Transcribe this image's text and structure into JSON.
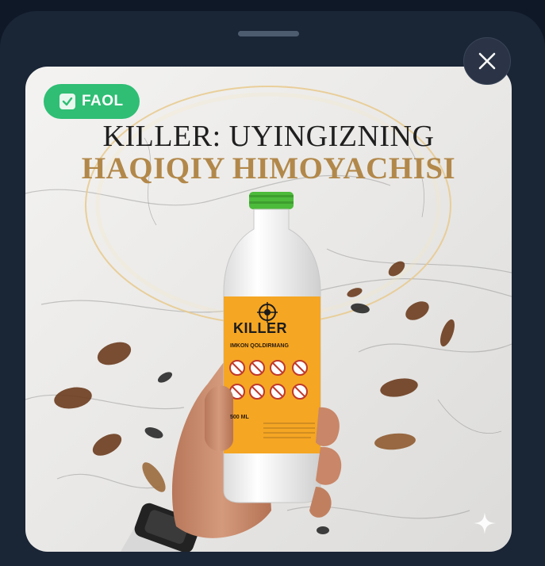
{
  "badge": {
    "icon": "check-mark-icon",
    "label": "FAOL"
  },
  "headline": {
    "line1": "KILLER: UYINGIZNING",
    "line2": "HAQIQIY HIMOYACHISI"
  },
  "product": {
    "brand": "KILLER",
    "tagline": "IMKON QOLDIRMANG",
    "volume": "500 ML"
  },
  "controls": {
    "close_icon": "close-icon",
    "sparkle_icon": "sparkle-icon"
  },
  "colors": {
    "badge": "#2fbe74",
    "headline_gold": "#b2884a",
    "label_orange": "#f5a623",
    "cap_green": "#4cba3a",
    "sheet_bg": "#1a2536"
  }
}
